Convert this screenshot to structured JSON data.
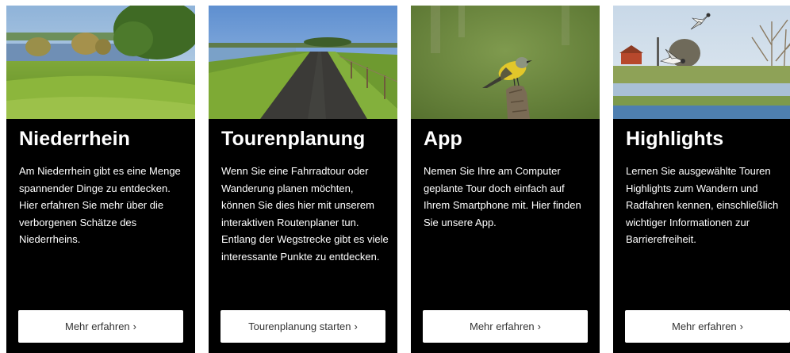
{
  "cards": [
    {
      "title": "Niederrhein",
      "text": "Am Niederrhein gibt es eine Menge spannender Dinge zu entdecken. Hier erfahren Sie mehr über die verborgenen Schätze des Niederrheins.",
      "button_label": "Mehr erfahren",
      "chevron": "›"
    },
    {
      "title": "Tourenplanung",
      "text": "Wenn Sie eine Fahrradtour oder Wanderung planen möchten, können Sie dies hier mit unserem interaktiven Routenplaner tun. Entlang der Wegstrecke gibt es viele interessante Punkte zu entdecken.",
      "button_label": "Tourenplanung starten",
      "chevron": "›"
    },
    {
      "title": "App",
      "text": "Nemen Sie Ihre am Computer geplante Tour doch einfach auf Ihrem Smartphone mit. Hier finden Sie unsere App.",
      "button_label": "Mehr erfahren",
      "chevron": "›"
    },
    {
      "title": "Highlights",
      "text": "Lernen Sie ausgewählte Touren Highlights zum Wandern und Radfahren kennen, einschließlich wichtiger Informationen zur Barrierefreiheit.",
      "button_label": "Mehr erfahren",
      "chevron": "›"
    }
  ],
  "colors": {
    "card_background": "#000000",
    "button_background": "#ffffff",
    "button_text": "#333333",
    "title_text": "#ffffff"
  }
}
